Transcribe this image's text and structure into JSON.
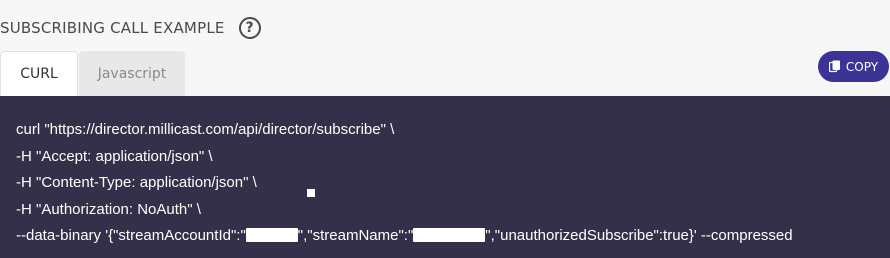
{
  "section": {
    "title": "SUBSCRIBING CALL EXAMPLE",
    "help_glyph": "?"
  },
  "tabs": [
    {
      "label": "CURL",
      "active": true
    },
    {
      "label": "Javascript",
      "active": false
    }
  ],
  "copy_button": {
    "label": "COPY",
    "icon": "copy-icon",
    "color": "#3b3396"
  },
  "code": {
    "background": "#34304a",
    "lines": [
      "curl \"https://director.millicast.com/api/director/subscribe\" \\",
      "-H \"Accept: application/json\" \\",
      "-H \"Content-Type: application/json\" \\",
      "-H \"Authorization: NoAuth\" \\"
    ],
    "data_line": {
      "part1": "--data-binary '{\"streamAccountId\":\"",
      "part2": "\",\"streamName\":\"",
      "part3": "\",\"unauthorizedSubscribe\":true}' --compressed"
    }
  }
}
